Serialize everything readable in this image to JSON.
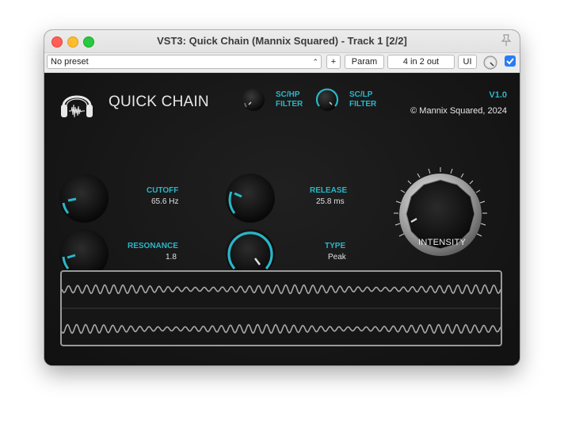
{
  "window": {
    "title": "VST3: Quick Chain (Mannix Squared) - Track 1 [2/2]"
  },
  "toolbar": {
    "preset_value": "No preset",
    "plus_label": "+",
    "param_label": "Param",
    "io_label": "4 in 2 out",
    "ui_label": "UI",
    "enabled_checked": true
  },
  "plugin": {
    "brand_name": "QUICK CHAIN",
    "version": "V1.0",
    "copyright": "© Mannix Squared, 2024",
    "sc_hp_filter": {
      "label_line1": "SC/HP",
      "label_line2": "FILTER"
    },
    "sc_lp_filter": {
      "label_line1": "SC/LP",
      "label_line2": "FILTER"
    },
    "cutoff": {
      "label": "CUTOFF",
      "value": "65.6 Hz"
    },
    "release": {
      "label": "RELEASE",
      "value": "25.8 ms"
    },
    "resonance": {
      "label": "RESONANCE",
      "value": "1.8"
    },
    "type": {
      "label": "TYPE",
      "value": "Peak"
    },
    "intensity": {
      "label": "INTENSITY"
    },
    "accent_color": "#2ab6c8"
  }
}
